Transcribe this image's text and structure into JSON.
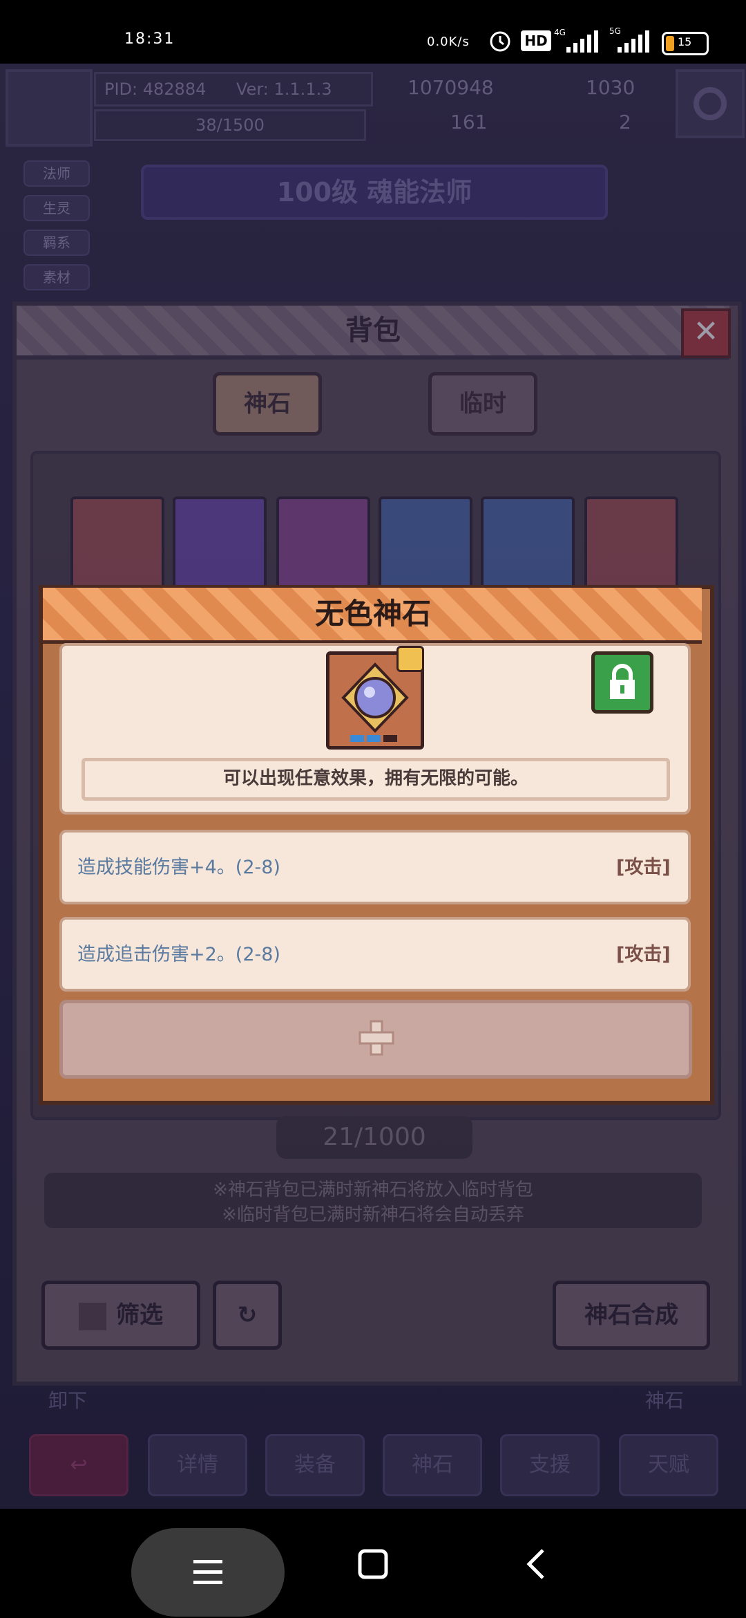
{
  "status_bar": {
    "time": "18:31",
    "net_speed": "0.0K/s",
    "badge_hd": "HD",
    "net_4g": "4G",
    "net_5g": "5G",
    "battery": "15"
  },
  "hud": {
    "pid": "PID: 482884",
    "version": "Ver: 1.1.1.3",
    "exp": "38/1500",
    "gold": "1070948",
    "gems": "1030",
    "item1": "161",
    "item2": "2"
  },
  "side_tags": [
    "法师",
    "生灵",
    "羁系",
    "素材"
  ],
  "char_title": "100级 魂能法师",
  "bag": {
    "title": "背包",
    "tab_godstone": "神石",
    "tab_temp": "临时",
    "count": "21/1000",
    "note1": "※神石背包已满时新神石将放入临时背包",
    "note2": "※临时背包已满时新神石将会自动丢弃",
    "filter_label": "筛选",
    "synth_label": "神石合成",
    "remove_label": "卸下",
    "godstone_small": "神石"
  },
  "nav_tabs": [
    "详情",
    "装备",
    "神石",
    "支援",
    "天赋"
  ],
  "dialog": {
    "title": "无色神石",
    "description": "可以出现任意效果，拥有无限的可能。",
    "effects": [
      {
        "text": "造成技能伤害+4。(2-8)",
        "tag": "[攻击]"
      },
      {
        "text": "造成追击伤害+2。(2-8)",
        "tag": "[攻击]"
      }
    ]
  },
  "colors": {
    "dialog_header": "#f2a56a",
    "effect_text": "#5a7aa0",
    "lock_green": "#3aa04a"
  }
}
